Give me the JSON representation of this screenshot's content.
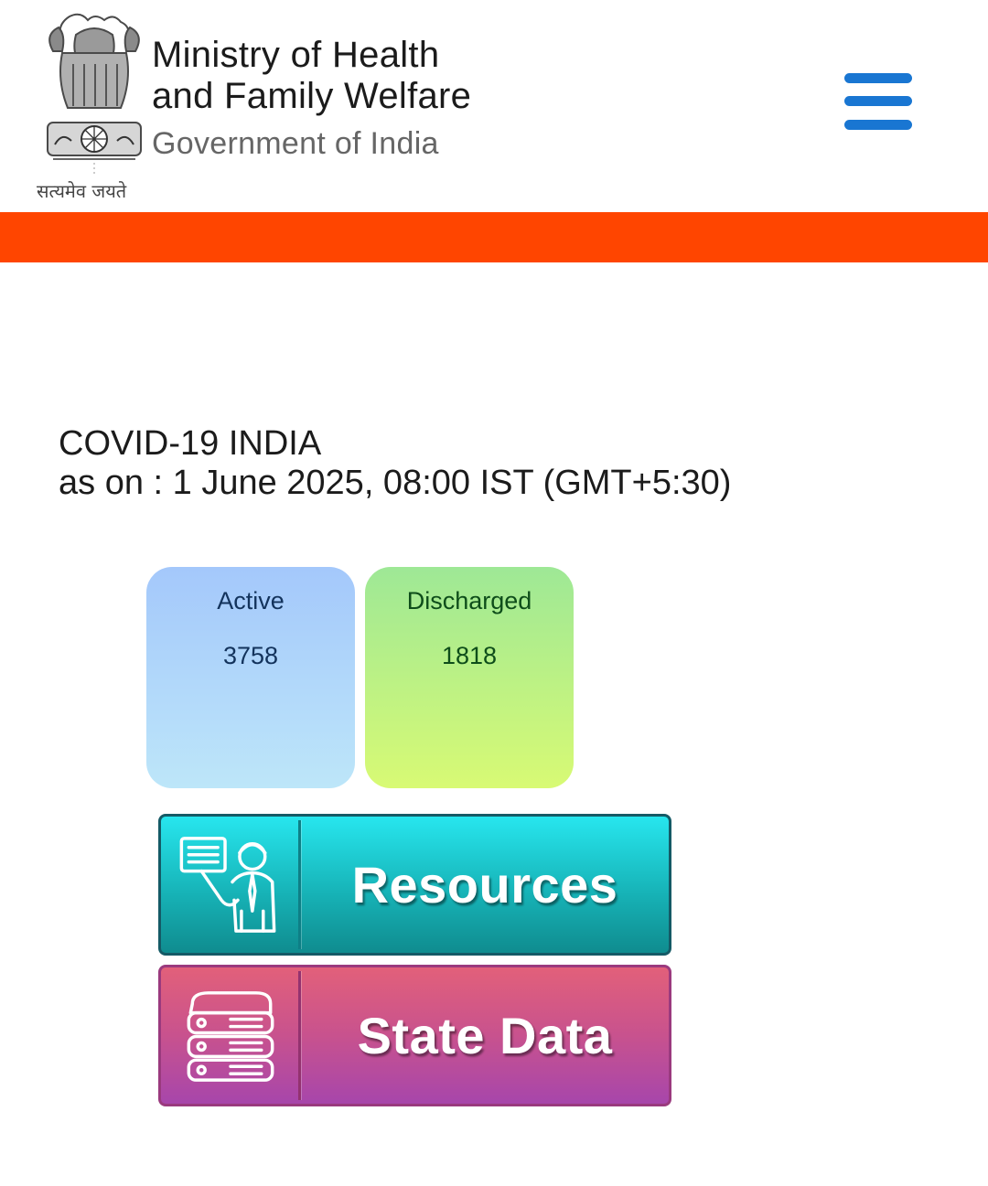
{
  "header": {
    "title_line1": "Ministry of Health",
    "title_line2": "and Family Welfare",
    "subtitle": "Government of India",
    "emblem_motto": "सत्यमेव जयते",
    "emblem_icon": "national-emblem-icon",
    "menu_icon": "hamburger-menu-icon"
  },
  "stats": {
    "heading": "COVID-19 INDIA",
    "as_on": "as on : 1 June 2025, 08:00 IST (GMT+5:30)",
    "cards": [
      {
        "label": "Active",
        "value": "3758"
      },
      {
        "label": "Discharged",
        "value": "1818"
      }
    ]
  },
  "buttons": {
    "resources": {
      "label": "Resources",
      "icon": "presenter-icon"
    },
    "state_data": {
      "label": "State Data",
      "icon": "database-server-icon"
    }
  },
  "colors": {
    "accent_band": "#ff4500",
    "menu_icon": "#1976d2",
    "resources_button": "#17b4b8",
    "state_data_button": "#c8528e"
  }
}
